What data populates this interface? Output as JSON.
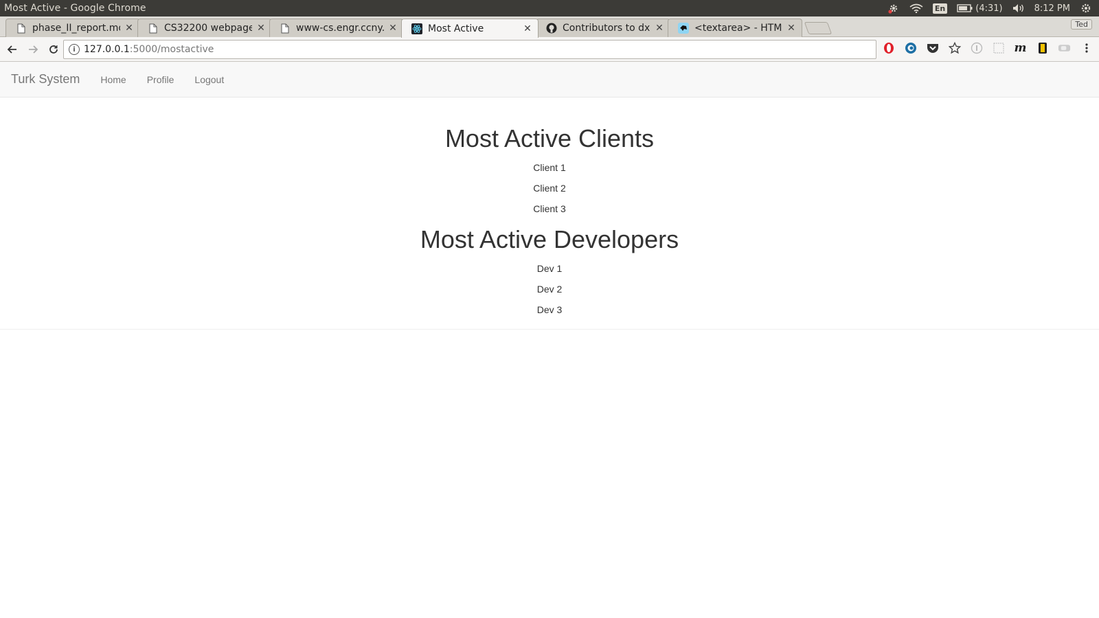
{
  "os_bar": {
    "window_title": "Most Active - Google Chrome",
    "battery": "(4:31)",
    "clock": "8:12 PM",
    "lang": "En"
  },
  "tabs": [
    {
      "label": "phase_II_report.md",
      "icon": "file-icon"
    },
    {
      "label": "CS32200 webpage",
      "icon": "file-icon"
    },
    {
      "label": "www-cs.engr.ccny.e",
      "icon": "file-icon"
    },
    {
      "label": "Most Active",
      "icon": "react-icon"
    },
    {
      "label": "Contributors to dx",
      "icon": "github-icon"
    },
    {
      "label": "<textarea> - HTML |",
      "icon": "mdn-icon"
    }
  ],
  "profile": "Ted",
  "address": {
    "host": "127.0.0.1",
    "path": ":5000/mostactive"
  },
  "navbar": {
    "brand": "Turk System",
    "links": [
      "Home",
      "Profile",
      "Logout"
    ]
  },
  "clients": {
    "title": "Most Active Clients",
    "items": [
      "Client 1",
      "Client 2",
      "Client 3"
    ]
  },
  "developers": {
    "title": "Most Active Developers",
    "items": [
      "Dev 1",
      "Dev 2",
      "Dev 3"
    ]
  },
  "colors": {
    "os_bar": "#3c3b37",
    "navbar_bg": "#f8f8f8",
    "nav_text": "#777777",
    "heading": "#333333"
  }
}
